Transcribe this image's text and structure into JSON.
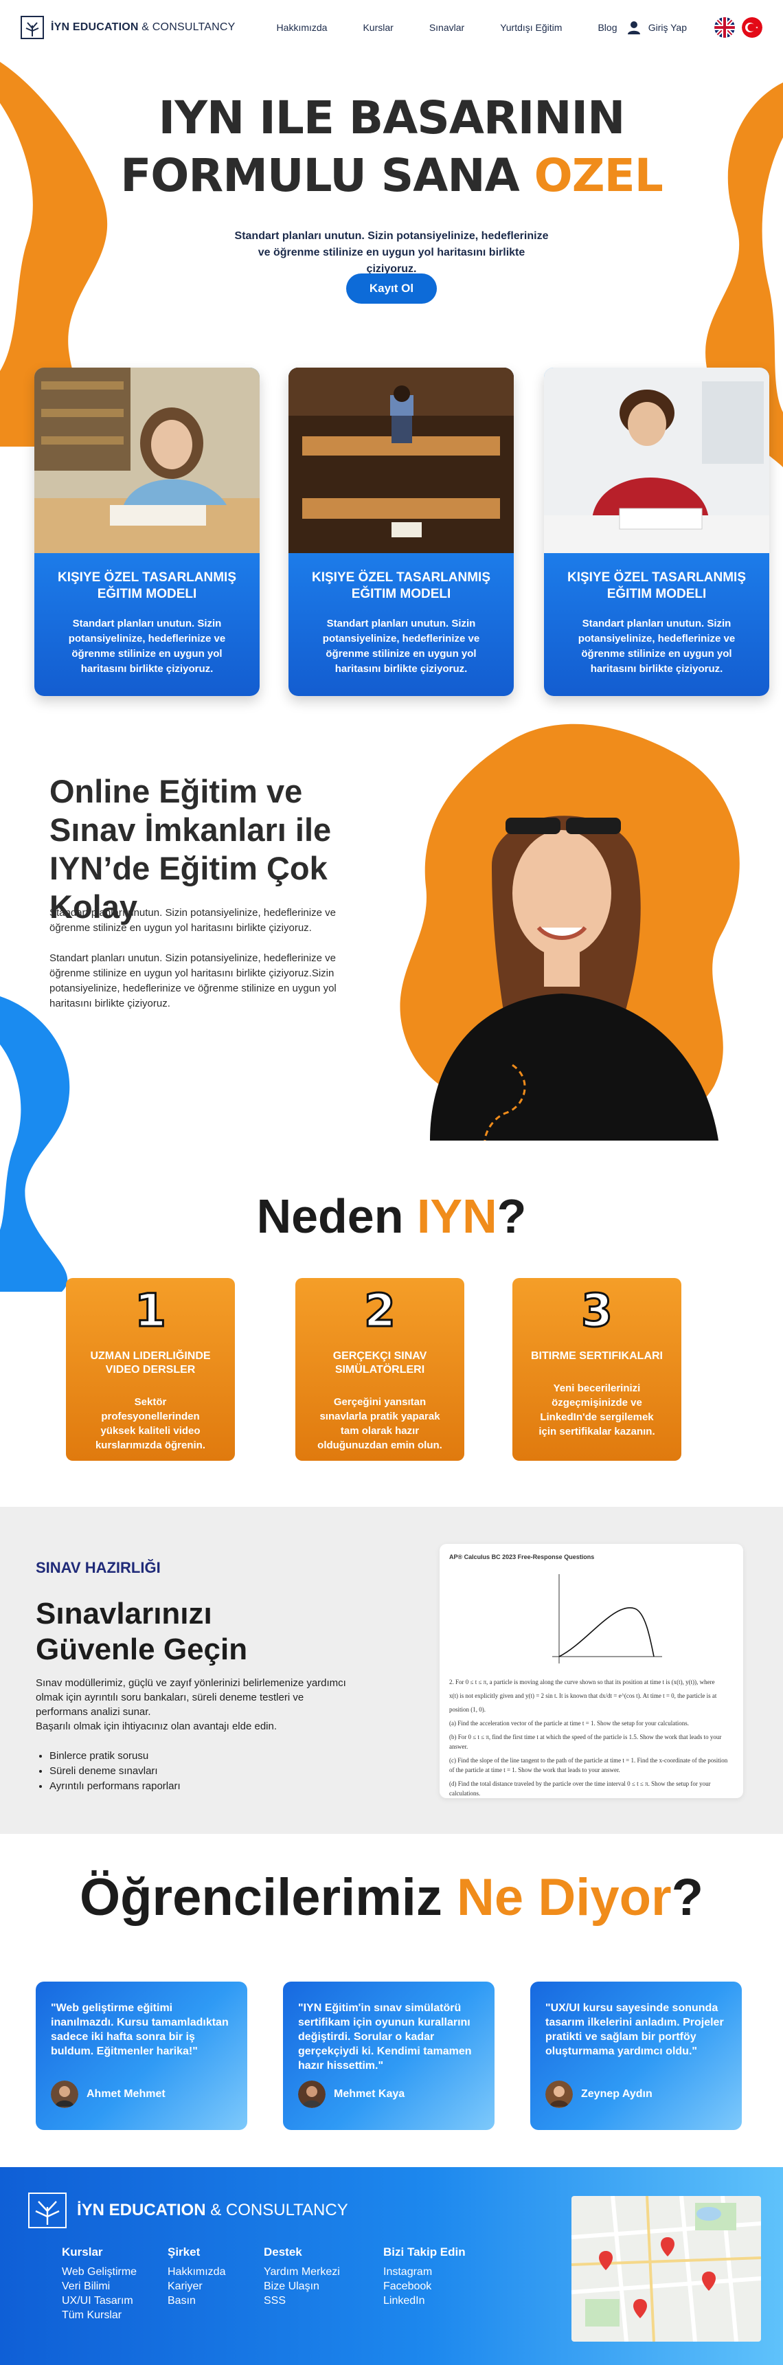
{
  "header": {
    "logo_bold": "İYN EDUCATION",
    "logo_rest": " & CONSULTANCY",
    "nav": [
      "Hakkımızda",
      "Kurslar",
      "Sınavlar",
      "Yurtdışı Eğitim",
      "Blog"
    ],
    "login_label": "Giriş Yap"
  },
  "hero": {
    "title_line1": "IYN ILE BASARININ",
    "title_line2": "FORMULU SANA ",
    "title_accent": "OZEL",
    "subtitle": "Standart planları unutun. Sizin potansiyelinize, hedeflerinize ve öğrenme stilinize en uygun yol haritasını birlikte çiziyoruz.",
    "cta_label": "Kayıt Ol"
  },
  "cards": [
    {
      "title": "KIŞIYE ÖZEL TASARLANMIŞ EĞITIM MODELI",
      "text": "Standart planları unutun. Sizin potansiyelinize, hedeflerinize ve öğrenme stilinize en uygun yol haritasını birlikte çiziyoruz."
    },
    {
      "title": "KIŞIYE ÖZEL TASARLANMIŞ EĞITIM MODELI",
      "text": "Standart planları unutun. Sizin potansiyelinize, hedeflerinize ve öğrenme stilinize en uygun yol haritasını birlikte çiziyoruz."
    },
    {
      "title": "KIŞIYE ÖZEL TASARLANMIŞ EĞITIM MODELI",
      "text": "Standart planları unutun. Sizin potansiyelinize, hedeflerinize ve öğrenme stilinize en uygun yol haritasını birlikte çiziyoruz."
    }
  ],
  "online": {
    "title": "Online Eğitim ve Sınav İmkanları ile IYN’de Eğitim Çok Kolay",
    "p1": "Standart planları unutun. Sizin potansiyelinize, hedeflerinize ve öğrenme stilinize en uygun yol haritasını birlikte çiziyoruz.",
    "p2": "Standart planları unutun. Sizin potansiyelinize, hedeflerinize ve öğrenme stilinize en uygun yol haritasını birlikte çiziyoruz.Sizin potansiyelinize, hedeflerinize ve öğrenme stilinize en uygun yol haritasını birlikte çiziyoruz."
  },
  "why": {
    "title": "Neden ",
    "title_accent": "IYN",
    "title_end": "?",
    "items": [
      {
        "num": "1",
        "head": "UZMAN LIDERLIĞINDE VIDEO DERSLER",
        "text": "Sektör profesyonellerinden yüksek kaliteli video kurslarımızda öğrenin."
      },
      {
        "num": "2",
        "head": "GERÇEKÇI SINAV SIMÜLATÖRLERI",
        "text": "Gerçeğini yansıtan sınavlarla pratik yaparak tam olarak hazır olduğunuzdan emin olun."
      },
      {
        "num": "3",
        "head": "BITIRME SERTIFIKALARI",
        "text": "Yeni becerilerinizi özgeçmişinizde ve LinkedIn'de sergilemek için sertifikalar kazanın."
      }
    ]
  },
  "exam": {
    "kicker": "SINAV HAZIRLIĞI",
    "title_line1": "Sınavlarınızı",
    "title_line2": "Güvenle Geçin",
    "p1": "Sınav modüllerimiz, güçlü ve zayıf yönlerinizi belirlemenize yardımcı olmak için ayrıntılı soru bankaları, süreli deneme testleri ve performans analizi sunar.",
    "p2": "Başarılı olmak için ihtiyacınız olan avantajı elde edin.",
    "list": [
      "Binlerce pratik sorusu",
      "Süreli deneme sınavları",
      "Ayrıntılı performans raporları"
    ],
    "doc_title": "AP® Calculus BC 2023 Free-Response Questions",
    "doc_lines": [
      "2. For 0 ≤ t ≤ π, a particle is moving along the curve shown so that its position at time t is (x(t), y(t)), where",
      "x(t) is not explicitly given and y(t) = 2 sin t. It is known that dx/dt = e^(cos t). At time t = 0, the particle is at",
      "position (1, 0).",
      "(a) Find the acceleration vector of the particle at time t = 1. Show the setup for your calculations.",
      "(b) For 0 ≤ t ≤ π, find the first time t at which the speed of the particle is 1.5. Show the work that leads to your answer.",
      "(c) Find the slope of the line tangent to the path of the particle at time t = 1. Find the x-coordinate of the position of the particle at time t = 1. Show the work that leads to your answer.",
      "(d) Find the total distance traveled by the particle over the time interval 0 ≤ t ≤ π. Show the setup for your calculations."
    ]
  },
  "testimonials": {
    "title": "Öğrencilerimiz ",
    "title_accent": "Ne Diyor",
    "title_end": "?",
    "items": [
      {
        "quote": "\"Web geliştirme eğitimi inanılmazdı. Kursu tamamladıktan sadece iki hafta sonra bir iş buldum. Eğitmenler harika!\"",
        "name": "Ahmet Mehmet"
      },
      {
        "quote": "\"IYN Eğitim'in sınav simülatörü sertifikam için oyunun kurallarını değiştirdi. Sorular o kadar gerçekçiydi ki. Kendimi tamamen hazır hissettim.\"",
        "name": "Mehmet Kaya"
      },
      {
        "quote": "\"UX/UI kursu sayesinde sonunda tasarım ilkelerini anladım. Projeler pratikti ve sağlam bir portföy oluşturmama yardımcı oldu.\"",
        "name": "Zeynep Aydın"
      }
    ]
  },
  "footer": {
    "logo_bold": "İYN EDUCATION",
    "logo_rest": " & CONSULTANCY",
    "cols": [
      {
        "head": "Kurslar",
        "links": [
          "Web Geliştirme",
          "Veri Bilimi",
          "UX/UI Tasarım",
          "Tüm Kurslar"
        ]
      },
      {
        "head": "Şirket",
        "links": [
          "Hakkımızda",
          "Kariyer",
          "Basın"
        ]
      },
      {
        "head": "Destek",
        "links": [
          "Yardım Merkezi",
          "Bize Ulaşın",
          "SSS"
        ]
      },
      {
        "head": "Bizi Takip Edin",
        "links": [
          "Instagram",
          "Facebook",
          "LinkedIn"
        ]
      }
    ]
  },
  "colors": {
    "accent": "#f08c1b",
    "brand_blue": "#0d6bd8",
    "navy": "#1f2a78"
  },
  "icons": [
    "logo-tree-icon",
    "user-icon",
    "uk-flag-icon",
    "tr-flag-icon",
    "location-pin-icon"
  ]
}
